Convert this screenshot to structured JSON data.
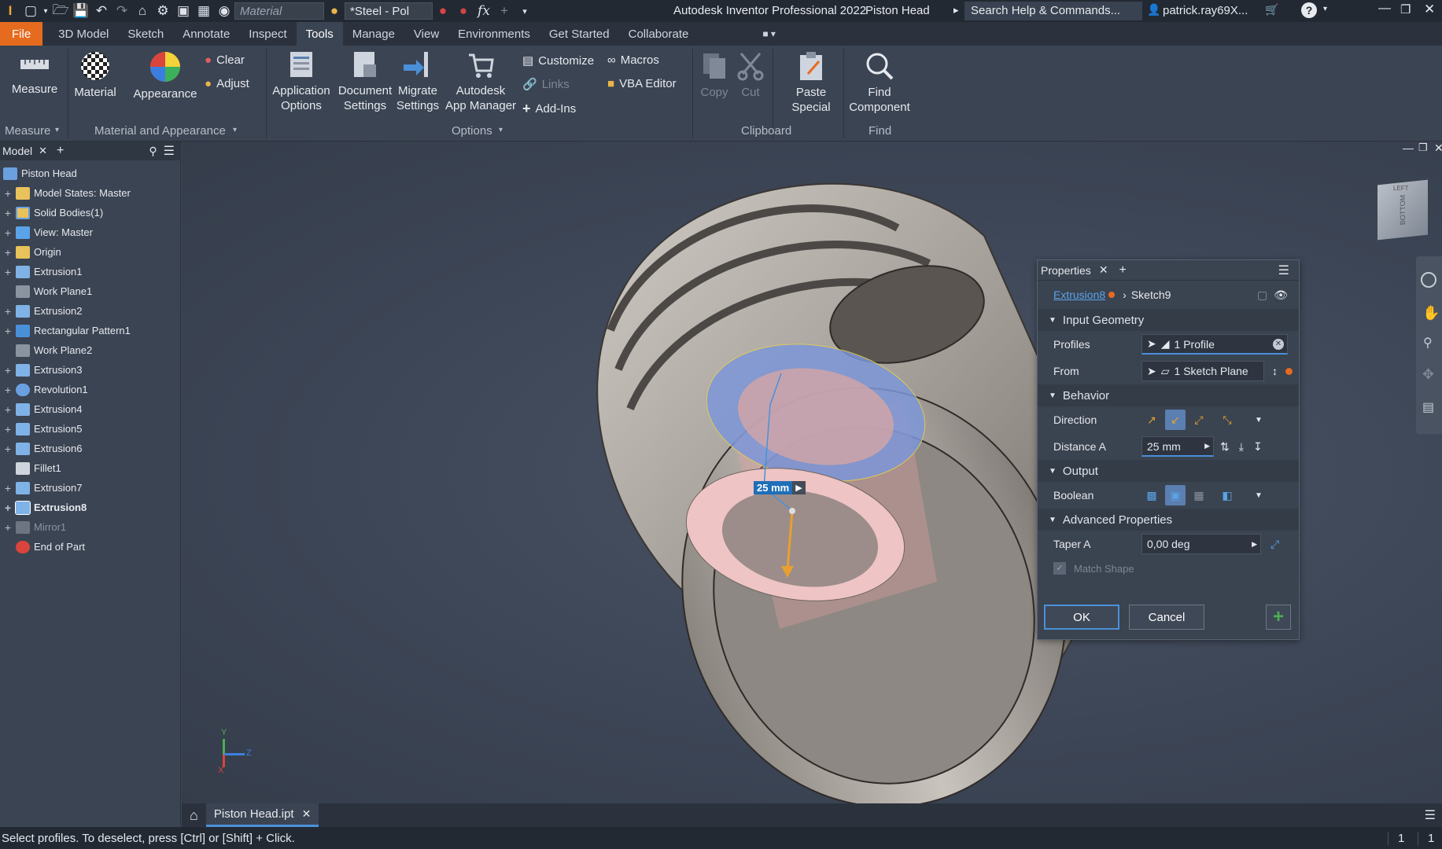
{
  "titlebar": {
    "material_placeholder": "Material",
    "appearance_value": "*Steel - Pol",
    "app_title": "Autodesk Inventor Professional 2022",
    "doc_title": "Piston Head",
    "search_placeholder": "Search Help & Commands...",
    "user": "patrick.ray69X..."
  },
  "menu": {
    "tabs": [
      "File",
      "3D Model",
      "Sketch",
      "Annotate",
      "Inspect",
      "Tools",
      "Manage",
      "View",
      "Environments",
      "Get Started",
      "Collaborate"
    ],
    "active": "Tools"
  },
  "ribbon": {
    "measure": "Measure",
    "material": "Material",
    "appearance": "Appearance",
    "clear": "Clear",
    "adjust": "Adjust",
    "application_options": "Application\nOptions",
    "app_opt_1": "Application",
    "app_opt_2": "Options",
    "doc_set_1": "Document",
    "doc_set_2": "Settings",
    "mig_set_1": "Migrate",
    "mig_set_2": "Settings",
    "app_mgr_1": "Autodesk",
    "app_mgr_2": "App Manager",
    "customize": "Customize",
    "links": "Links",
    "addins": "Add-Ins",
    "macros": "Macros",
    "vba_editor": "VBA Editor",
    "copy": "Copy",
    "cut": "Cut",
    "paste_1": "Paste",
    "paste_2": "Special",
    "find_1": "Find",
    "find_2": "Component",
    "panels": {
      "measure": "Measure",
      "material_appearance": "Material and Appearance",
      "options": "Options",
      "clipboard": "Clipboard",
      "find": "Find"
    }
  },
  "browser": {
    "tab": "Model",
    "items": [
      {
        "label": "Piston Head",
        "icon": "part",
        "expand": ""
      },
      {
        "label": "Model States: Master",
        "icon": "folder",
        "expand": "+"
      },
      {
        "label": "Solid Bodies(1)",
        "icon": "folder-solid",
        "expand": "+"
      },
      {
        "label": "View: Master",
        "icon": "view",
        "expand": "+"
      },
      {
        "label": "Origin",
        "icon": "folder",
        "expand": "+"
      },
      {
        "label": "Extrusion1",
        "icon": "extrusion",
        "expand": "+"
      },
      {
        "label": "Work Plane1",
        "icon": "plane",
        "expand": ""
      },
      {
        "label": "Extrusion2",
        "icon": "extrusion",
        "expand": "+"
      },
      {
        "label": "Rectangular Pattern1",
        "icon": "pattern",
        "expand": "+"
      },
      {
        "label": "Work Plane2",
        "icon": "plane",
        "expand": ""
      },
      {
        "label": "Extrusion3",
        "icon": "extrusion",
        "expand": "+"
      },
      {
        "label": "Revolution1",
        "icon": "revolve",
        "expand": "+"
      },
      {
        "label": "Extrusion4",
        "icon": "extrusion",
        "expand": "+"
      },
      {
        "label": "Extrusion5",
        "icon": "extrusion",
        "expand": "+"
      },
      {
        "label": "Extrusion6",
        "icon": "extrusion",
        "expand": "+"
      },
      {
        "label": "Fillet1",
        "icon": "fillet",
        "expand": ""
      },
      {
        "label": "Extrusion7",
        "icon": "extrusion",
        "expand": "+"
      },
      {
        "label": "Extrusion8",
        "icon": "extrusion-edit",
        "expand": "+",
        "bold": true
      },
      {
        "label": "Mirror1",
        "icon": "mirror",
        "expand": "+",
        "dim": true
      },
      {
        "label": "End of Part",
        "icon": "end-of-part",
        "expand": ""
      }
    ]
  },
  "viewport": {
    "distance_label": "25 mm",
    "viewcube_label": "BOTTOM",
    "viewcube_top": "LEFT",
    "axis_y": "Y",
    "axis_z": "Z",
    "axis_x": "X"
  },
  "properties": {
    "title": "Properties",
    "breadcrumb_feature": "Extrusion8",
    "breadcrumb_sketch": "Sketch9",
    "input_geometry": "Input Geometry",
    "profiles_label": "Profiles",
    "profiles_value": "1 Profile",
    "from_label": "From",
    "from_value": "1 Sketch Plane",
    "behavior": "Behavior",
    "direction_label": "Direction",
    "distance_label": "Distance A",
    "distance_value": "25 mm",
    "output": "Output",
    "boolean_label": "Boolean",
    "advanced": "Advanced Properties",
    "taper_label": "Taper A",
    "taper_value": "0,00 deg",
    "match_shape": "Match Shape",
    "ok": "OK",
    "cancel": "Cancel"
  },
  "doctabs": {
    "active": "Piston Head.ipt"
  },
  "status": {
    "message": "Select profiles. To deselect, press [Ctrl] or [Shift] + Click.",
    "count1": "1",
    "count2": "1"
  },
  "colors": {
    "accent_orange": "#e56b1f",
    "selection_blue": "#5a7fb0",
    "background": "#3b4453"
  }
}
